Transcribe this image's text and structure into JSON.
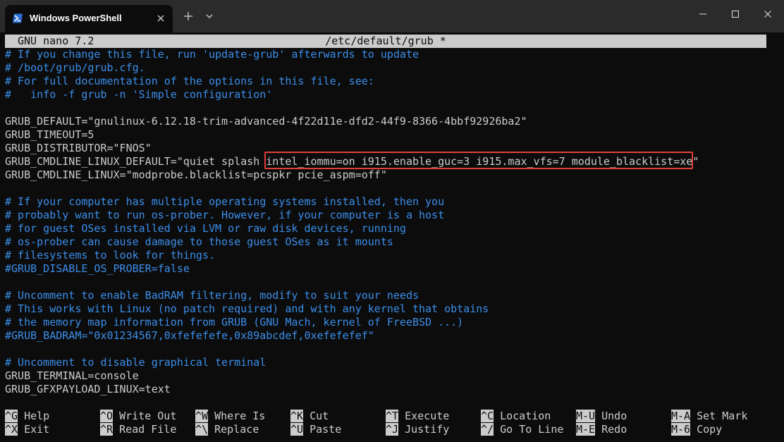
{
  "window": {
    "tab_title": "Windows PowerShell",
    "colors": {
      "titlebar": "#2b2b2b",
      "terminal_bg": "#0c0c0c",
      "comment": "#3b8eea",
      "text": "#cccccc",
      "highlight_box": "#e0403a"
    }
  },
  "nano": {
    "app": "GNU nano 7.2",
    "filename": "/etc/default/grub *",
    "lines": [
      {
        "text": "# If you change this file, run 'update-grub' afterwards to update",
        "comment": true
      },
      {
        "text": "# /boot/grub/grub.cfg.",
        "comment": true
      },
      {
        "text": "# For full documentation of the options in this file, see:",
        "comment": true
      },
      {
        "text": "#   info -f grub -n 'Simple configuration'",
        "comment": true
      },
      {
        "text": "",
        "comment": false
      },
      {
        "text": "GRUB_DEFAULT=\"gnulinux-6.12.18-trim-advanced-4f22d11e-dfd2-44f9-8366-4bbf92926ba2\"",
        "comment": false
      },
      {
        "text": "GRUB_TIMEOUT=5",
        "comment": false
      },
      {
        "text": "GRUB_DISTRIBUTOR=\"FNOS\"",
        "comment": false
      },
      {
        "text": "GRUB_CMDLINE_LINUX_DEFAULT=\"quiet splash intel_iommu=on i915.enable_guc=3 i915.max_vfs=7 module_blacklist=xe\"",
        "comment": false
      },
      {
        "text": "GRUB_CMDLINE_LINUX=\"modprobe.blacklist=pcspkr pcie_aspm=off\"",
        "comment": false
      },
      {
        "text": "",
        "comment": false
      },
      {
        "text": "# If your computer has multiple operating systems installed, then you",
        "comment": true
      },
      {
        "text": "# probably want to run os-prober. However, if your computer is a host",
        "comment": true
      },
      {
        "text": "# for guest OSes installed via LVM or raw disk devices, running",
        "comment": true
      },
      {
        "text": "# os-prober can cause damage to those guest OSes as it mounts",
        "comment": true
      },
      {
        "text": "# filesystems to look for things.",
        "comment": true
      },
      {
        "text": "#GRUB_DISABLE_OS_PROBER=false",
        "comment": true
      },
      {
        "text": "",
        "comment": false
      },
      {
        "text": "# Uncomment to enable BadRAM filtering, modify to suit your needs",
        "comment": true
      },
      {
        "text": "# This works with Linux (no patch required) and with any kernel that obtains",
        "comment": true
      },
      {
        "text": "# the memory map information from GRUB (GNU Mach, kernel of FreeBSD ...)",
        "comment": true
      },
      {
        "text": "#GRUB_BADRAM=\"0x01234567,0xfefefefe,0x89abcdef,0xefefefef\"",
        "comment": true
      },
      {
        "text": "",
        "comment": false
      },
      {
        "text": "# Uncomment to disable graphical terminal",
        "comment": true
      },
      {
        "text": "GRUB_TERMINAL=console",
        "comment": false
      },
      {
        "text": "GRUB_GFXPAYLOAD_LINUX=text",
        "comment": false
      }
    ],
    "shortcuts": [
      {
        "key": "^G",
        "label": "Help"
      },
      {
        "key": "^O",
        "label": "Write Out"
      },
      {
        "key": "^W",
        "label": "Where Is"
      },
      {
        "key": "^K",
        "label": "Cut"
      },
      {
        "key": "^T",
        "label": "Execute"
      },
      {
        "key": "^C",
        "label": "Location"
      },
      {
        "key": "M-U",
        "label": "Undo"
      },
      {
        "key": "M-A",
        "label": "Set Mark"
      },
      {
        "key": "^X",
        "label": "Exit"
      },
      {
        "key": "^R",
        "label": "Read File"
      },
      {
        "key": "^\\",
        "label": "Replace"
      },
      {
        "key": "^U",
        "label": "Paste"
      },
      {
        "key": "^J",
        "label": "Justify"
      },
      {
        "key": "^/",
        "label": "Go To Line"
      },
      {
        "key": "M-E",
        "label": "Redo"
      },
      {
        "key": "M-6",
        "label": "Copy"
      }
    ]
  }
}
